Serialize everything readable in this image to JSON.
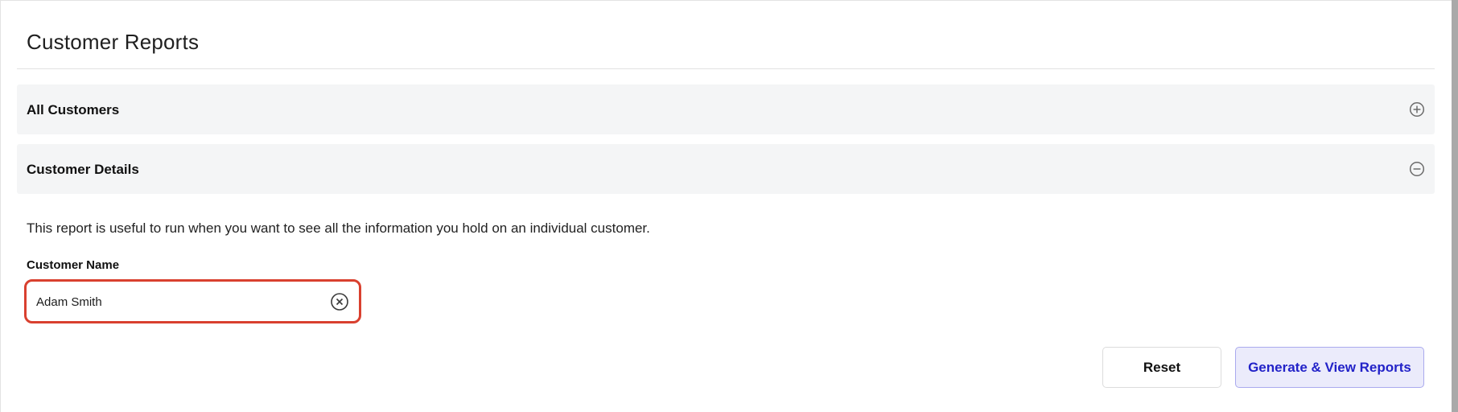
{
  "page": {
    "title": "Customer Reports"
  },
  "sections": [
    {
      "label": "All Customers",
      "expanded": false,
      "icon": "plus-circle-icon"
    },
    {
      "label": "Customer Details",
      "expanded": true,
      "icon": "minus-circle-icon"
    }
  ],
  "details": {
    "description": "This report is useful to run when you want to see all the information you hold on an individual customer.",
    "customer_name": {
      "label": "Customer Name",
      "value": "Adam Smith",
      "placeholder": "",
      "clear_icon": "clear-circle-icon"
    }
  },
  "actions": {
    "reset_label": "Reset",
    "generate_label": "Generate & View Reports"
  },
  "colors": {
    "accordion_bg": "#f4f5f6",
    "focus_border": "#d9402f",
    "primary_text": "#2222c8",
    "primary_bg": "#ebebfb",
    "primary_border": "#aaaaee"
  }
}
